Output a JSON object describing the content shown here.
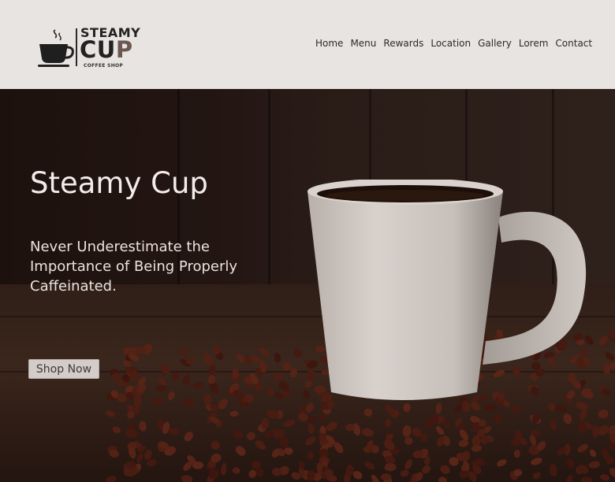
{
  "brand": {
    "name_top": "STEAMY",
    "name_cup_main": "CU",
    "name_cup_accent": "P",
    "tagline": "COFFEE SHOP",
    "logo_icon": "coffee-cup-icon"
  },
  "nav": {
    "items": [
      "Home",
      "Menu",
      "Rewards",
      "Location",
      "Gallery",
      "Lorem",
      "Contact"
    ]
  },
  "hero": {
    "title": "Steamy Cup",
    "subtitle": "Never Underestimate the Importance of Being Properly Caffeinated.",
    "cta_label": "Shop Now"
  },
  "colors": {
    "header_bg": "#e8e4e2",
    "hero_bg": "#1d110e",
    "logo_accent": "#6b5850",
    "button_bg": "#d4ccc8"
  }
}
